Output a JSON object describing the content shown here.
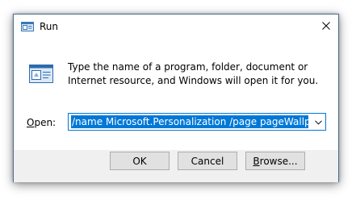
{
  "window": {
    "title": "Run"
  },
  "dialog": {
    "description": "Type the name of a program, folder, document or Internet resource, and Windows will open it for you.",
    "open_label_accel": "O",
    "open_label_rest": "pen:",
    "input_value": "/name Microsoft.Personalization /page pageWallpaper"
  },
  "buttons": {
    "ok": "OK",
    "cancel": "Cancel",
    "browse_accel": "B",
    "browse_rest": "rowse..."
  },
  "icons": {
    "title": "run-icon",
    "dialog": "run-icon",
    "close": "close-icon",
    "dropdown": "chevron-down-icon"
  },
  "colors": {
    "accent": "#0078d7",
    "footer": "#f0f0f0",
    "button_face": "#e1e1e1",
    "button_border": "#adadad"
  }
}
